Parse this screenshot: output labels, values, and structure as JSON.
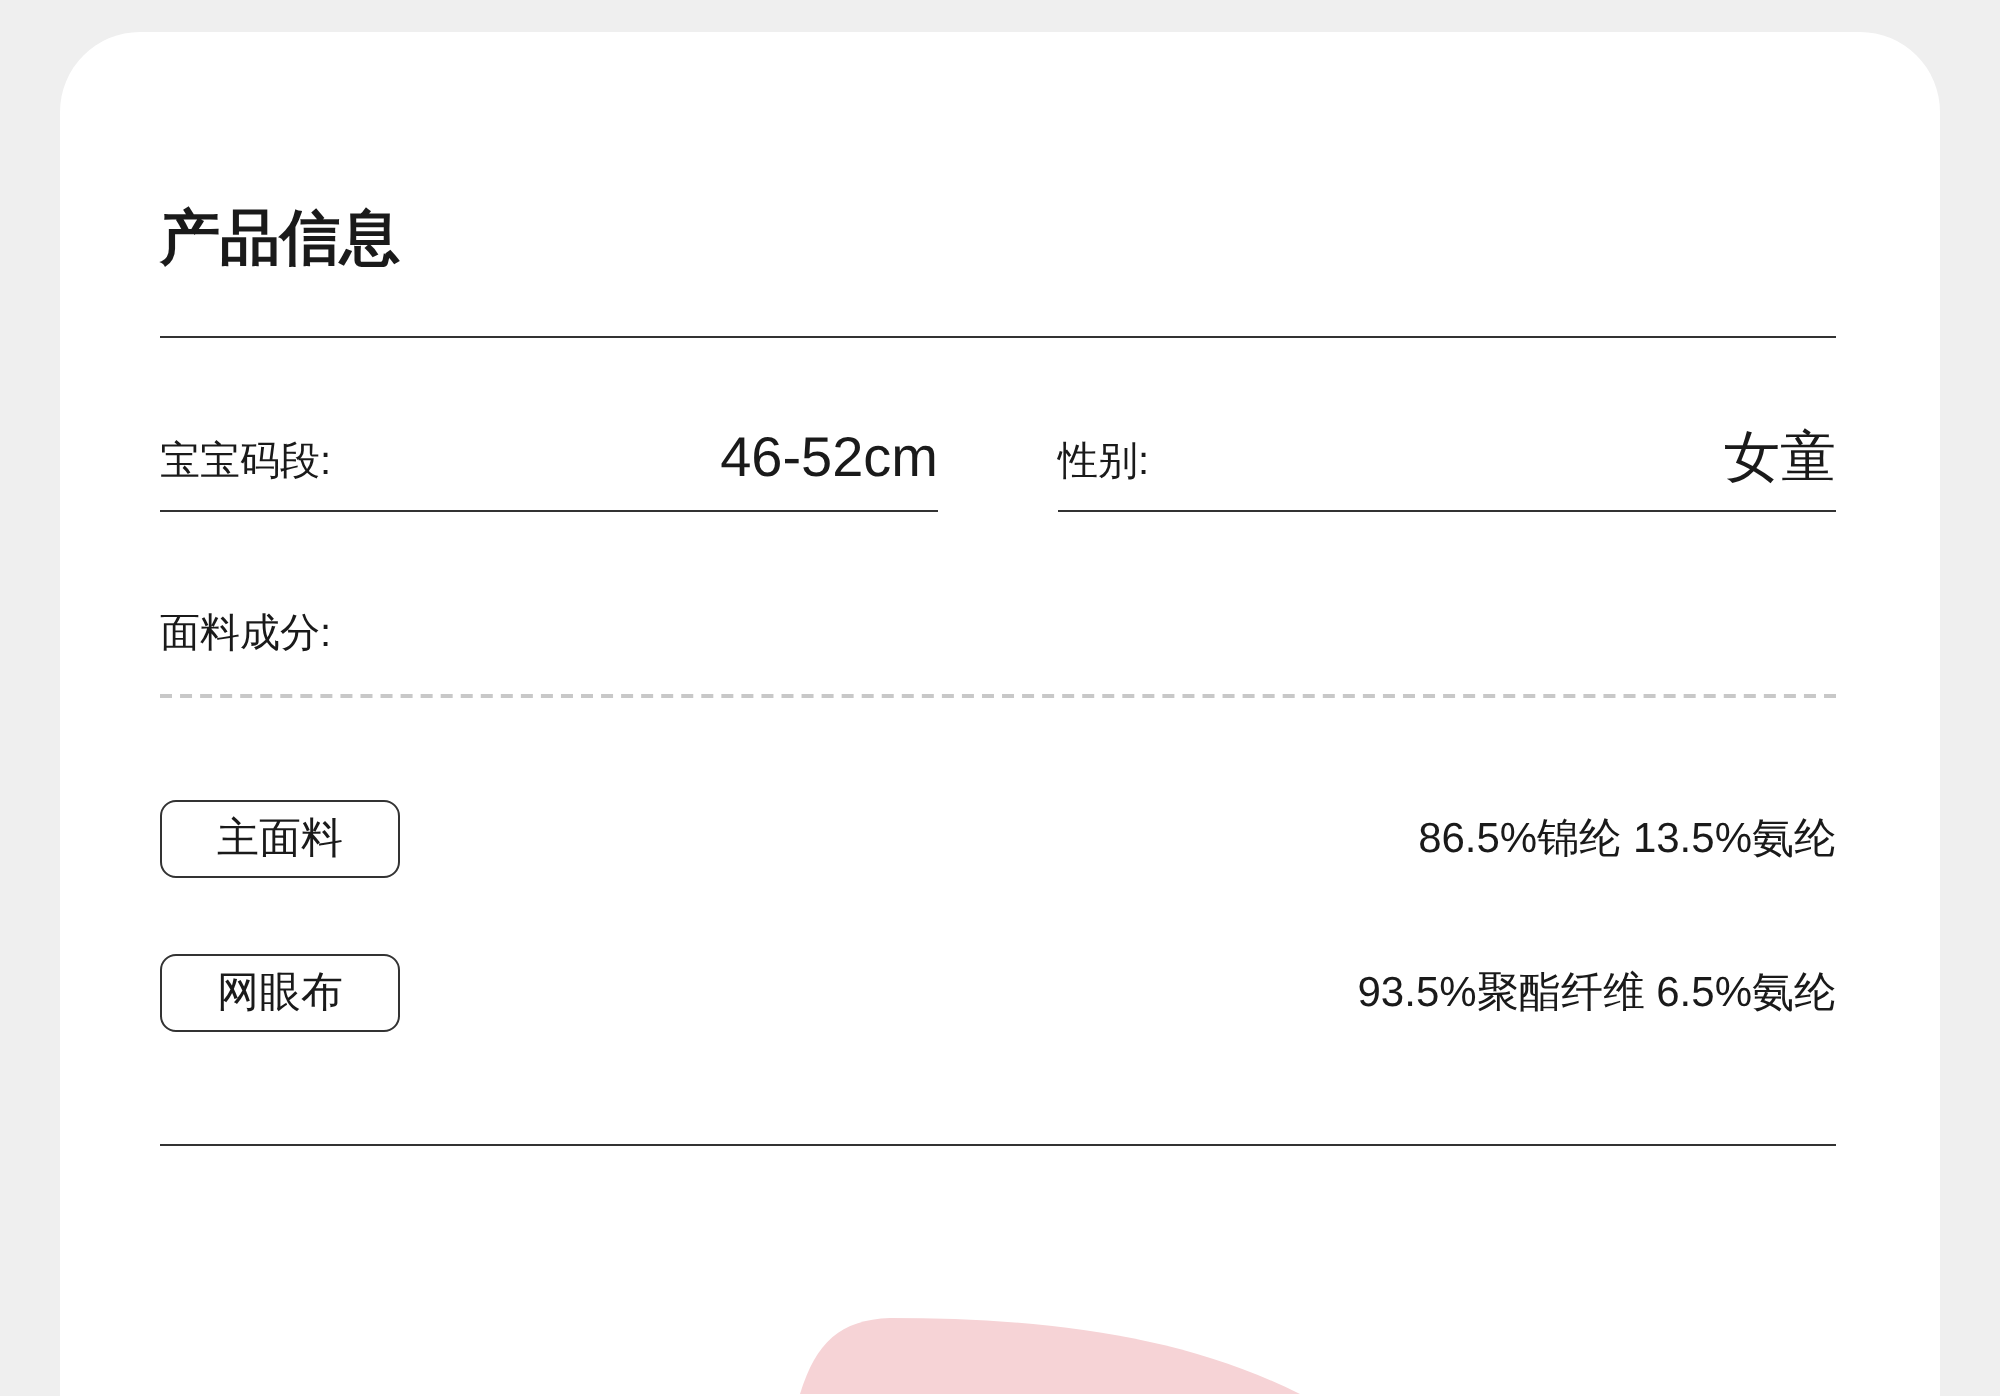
{
  "section_title": "产品信息",
  "specs": [
    {
      "label": "宝宝码段:",
      "value": "46-52cm"
    },
    {
      "label": "性别:",
      "value": "女童"
    }
  ],
  "fabric": {
    "label": "面料成分:",
    "rows": [
      {
        "tag": "主面料",
        "value": "86.5%锦纶 13.5%氨纶"
      },
      {
        "tag": "网眼布",
        "value": "93.5%聚酯纤维 6.5%氨纶"
      }
    ]
  }
}
